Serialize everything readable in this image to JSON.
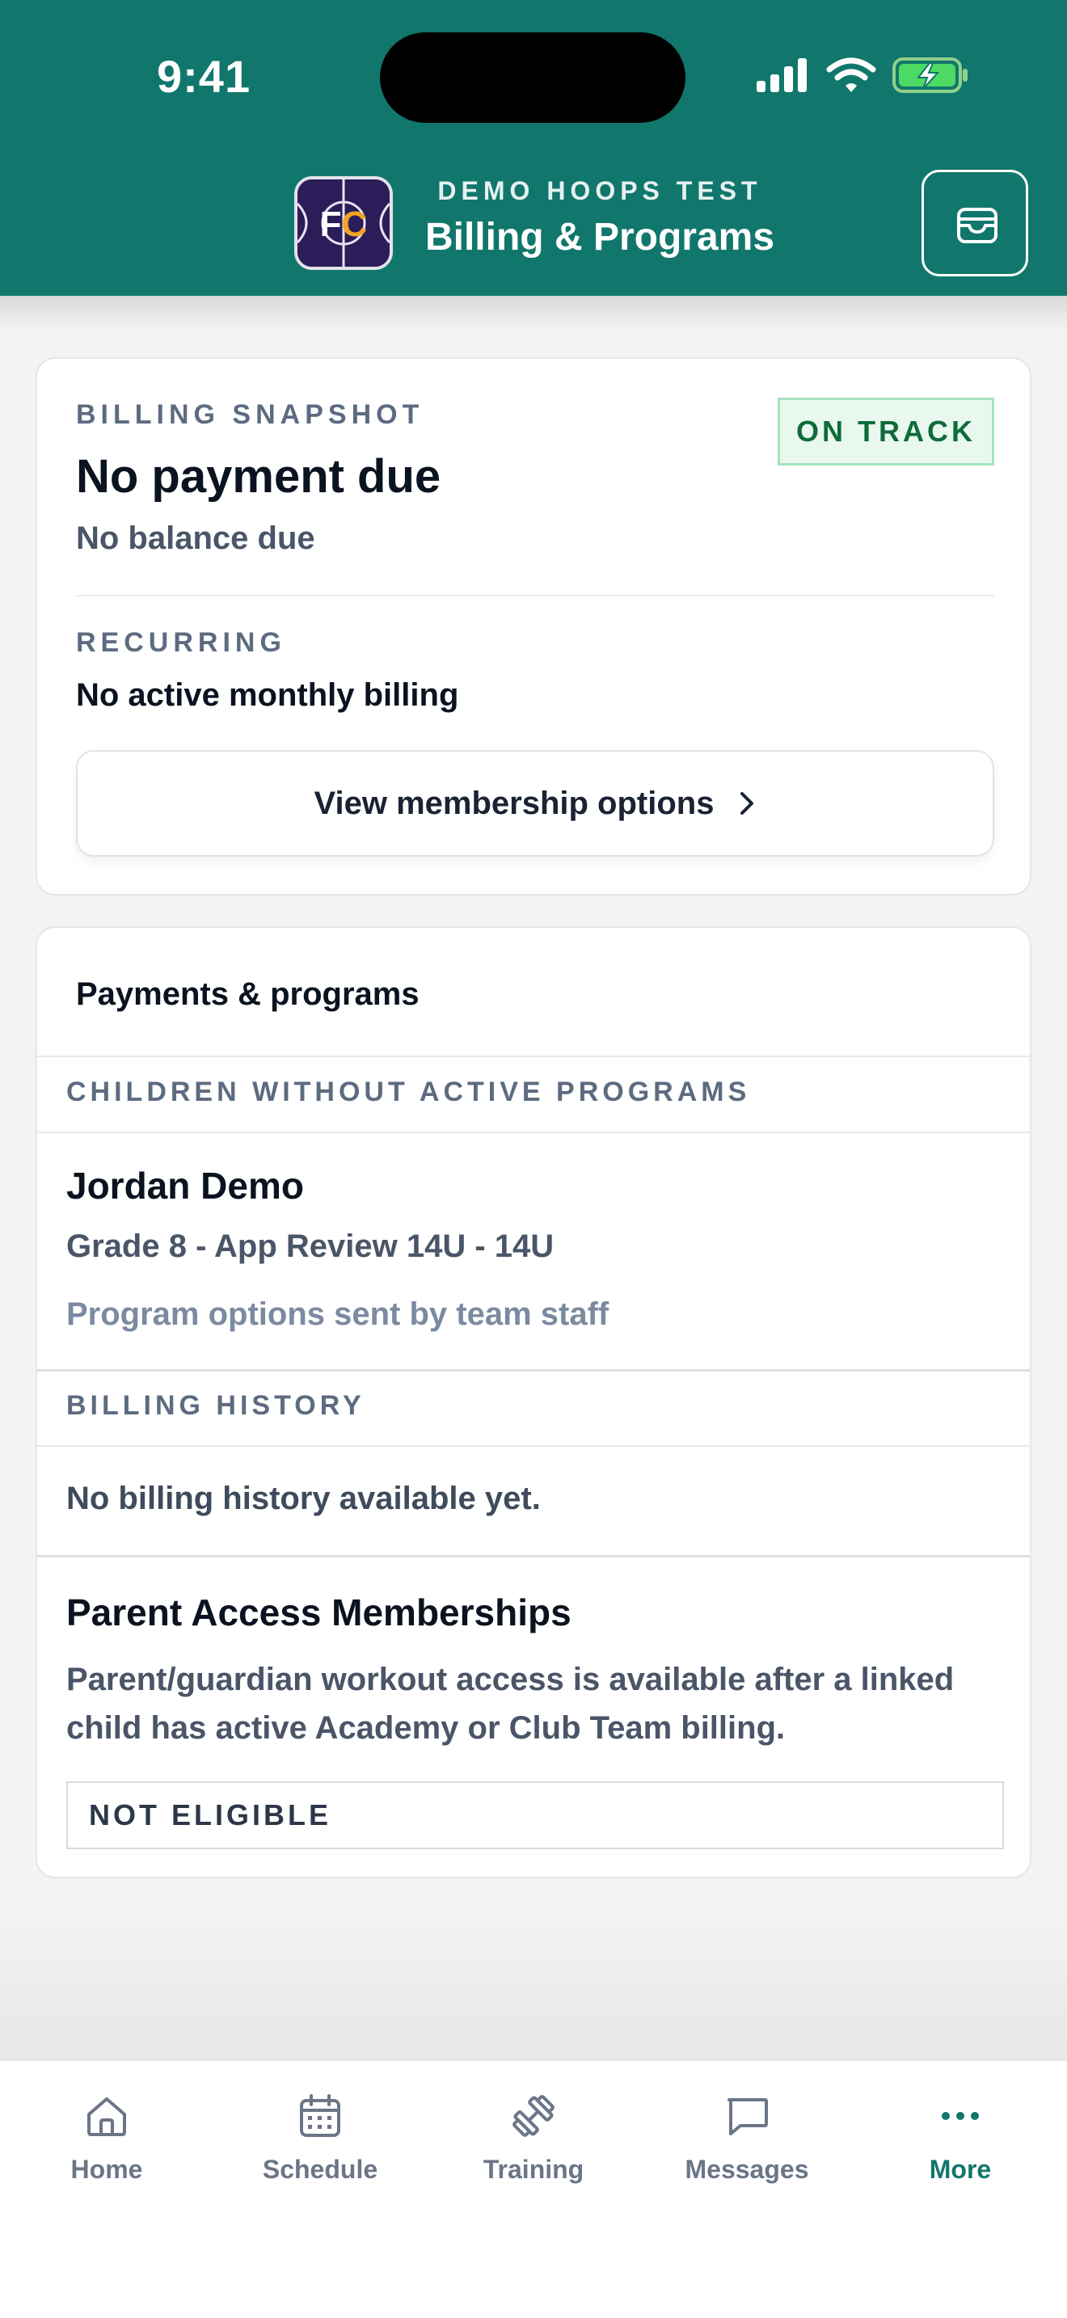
{
  "status_bar": {
    "time": "9:41",
    "icons": [
      "signal-icon",
      "wifi-icon",
      "battery-charging-icon"
    ]
  },
  "header": {
    "org_name": "DEMO HOOPS TEST",
    "title": "Billing & Programs",
    "logo_text": "FC",
    "action_icon": "wallet-icon",
    "background_color": "#11776c"
  },
  "billing_snapshot": {
    "label": "BILLING SNAPSHOT",
    "badge": "ON TRACK",
    "heading": "No payment due",
    "subtext": "No balance due",
    "recurring_label": "RECURRING",
    "recurring_value": "No active monthly billing",
    "membership_button": "View membership options"
  },
  "payments": {
    "title": "Payments & programs",
    "children_section_label": "CHILDREN WITHOUT ACTIVE PROGRAMS",
    "children": [
      {
        "name": "Jordan Demo",
        "detail": "Grade 8 - App Review 14U - 14U",
        "note": "Program options sent by team staff"
      }
    ],
    "history_label": "BILLING HISTORY",
    "history_empty": "No billing history available yet."
  },
  "parent_access": {
    "title": "Parent Access Memberships",
    "description": "Parent/guardian workout access is available after a linked child has active Academy or Club Team billing.",
    "status": "NOT ELIGIBLE"
  },
  "tabbar": {
    "items": [
      {
        "label": "Home",
        "icon": "home-icon",
        "active": false
      },
      {
        "label": "Schedule",
        "icon": "calendar-icon",
        "active": false
      },
      {
        "label": "Training",
        "icon": "dumbbell-icon",
        "active": false
      },
      {
        "label": "Messages",
        "icon": "message-icon",
        "active": false
      },
      {
        "label": "More",
        "icon": "more-dots-icon",
        "active": true
      }
    ],
    "active_color": "#11776c",
    "inactive_color": "#6b7587"
  }
}
